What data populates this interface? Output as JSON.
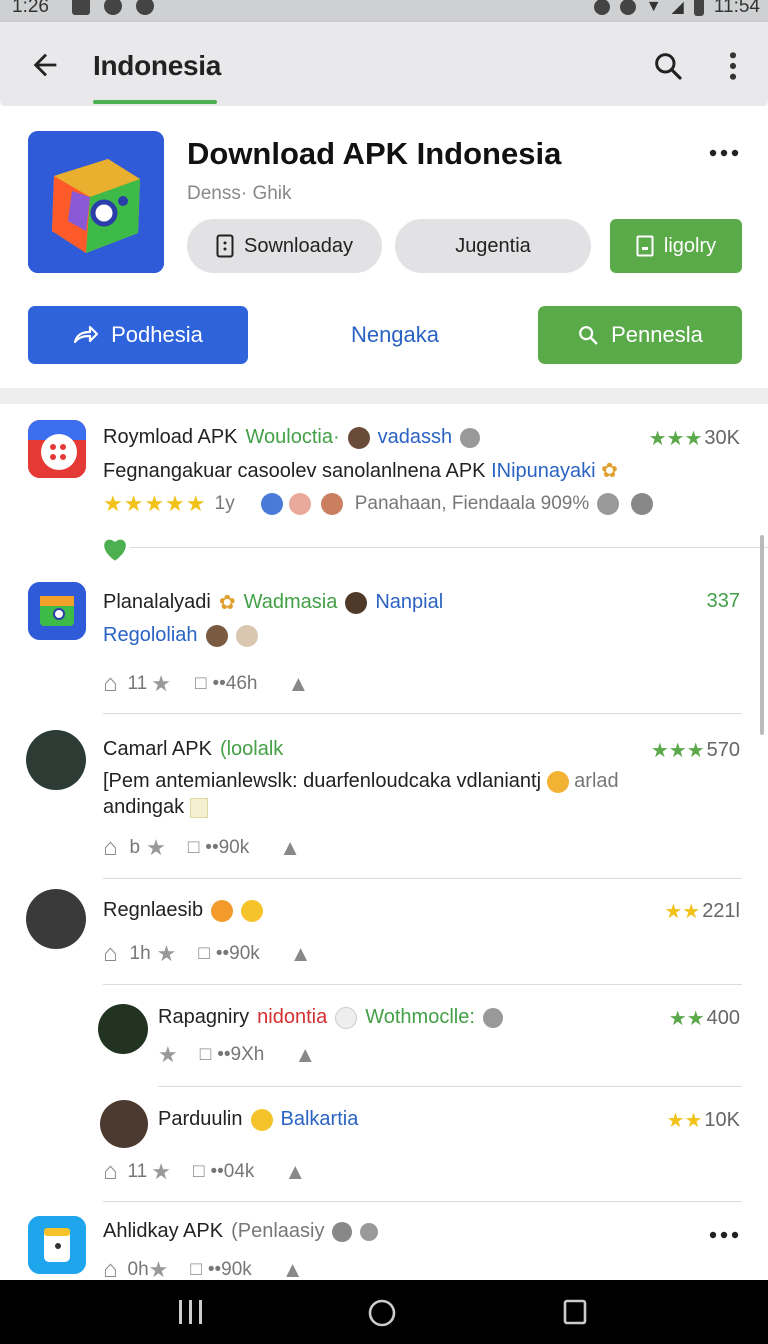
{
  "status_bar": {
    "time_left": "1:26",
    "time_right": "11:54"
  },
  "app_bar": {
    "title": "Indonesia"
  },
  "app": {
    "title": "Download APK Indonesia",
    "developer": "Denss· Ghik",
    "pill_1": "Sownloaday",
    "pill_2": "Jugentia",
    "pill_3": "ligolry",
    "button_blue": "Podhesia",
    "button_plain": "Nengaka",
    "button_green": "Pennesla"
  },
  "items": [
    {
      "title": "Roymload APK",
      "tag": "Wouloctia·",
      "user": "vadassh",
      "count": "30K",
      "body": "Fegnangakuar casoolev sanolanlnena APK",
      "body_link": "INipunayaki",
      "age": "1y",
      "meta": "Panahaan, Fiendaala 909%"
    },
    {
      "title": "Planalalyadi",
      "tag": "Wadmasia",
      "user": "Nanpial",
      "count": "337",
      "sub": "Regololiah",
      "likes": "11",
      "time": "••46h"
    },
    {
      "title": "Camarl APK",
      "tag": "(loolalk",
      "count": "570",
      "body": "[Pem antemianlewslk: duarfenloudcaka vdlaniantj",
      "body_tail": "arlad",
      "body2": "andingak",
      "likes": "b",
      "time": "••90k"
    },
    {
      "title": "Regnlaesib",
      "count": "221l",
      "likes": "1h",
      "time": "••90k"
    },
    {
      "title": "Rapagniry",
      "tag_red": "nidontia",
      "tag": "Wothmoclle:",
      "count": "400",
      "time": "••9Xh"
    },
    {
      "title": "Parduulin",
      "tag": "Balkartia",
      "count": "10K",
      "likes": "11",
      "time": "••04k"
    },
    {
      "title": "Ahlidkay APK",
      "tag": "(Penlaasiy",
      "likes": "0h",
      "time": "••90k"
    }
  ]
}
